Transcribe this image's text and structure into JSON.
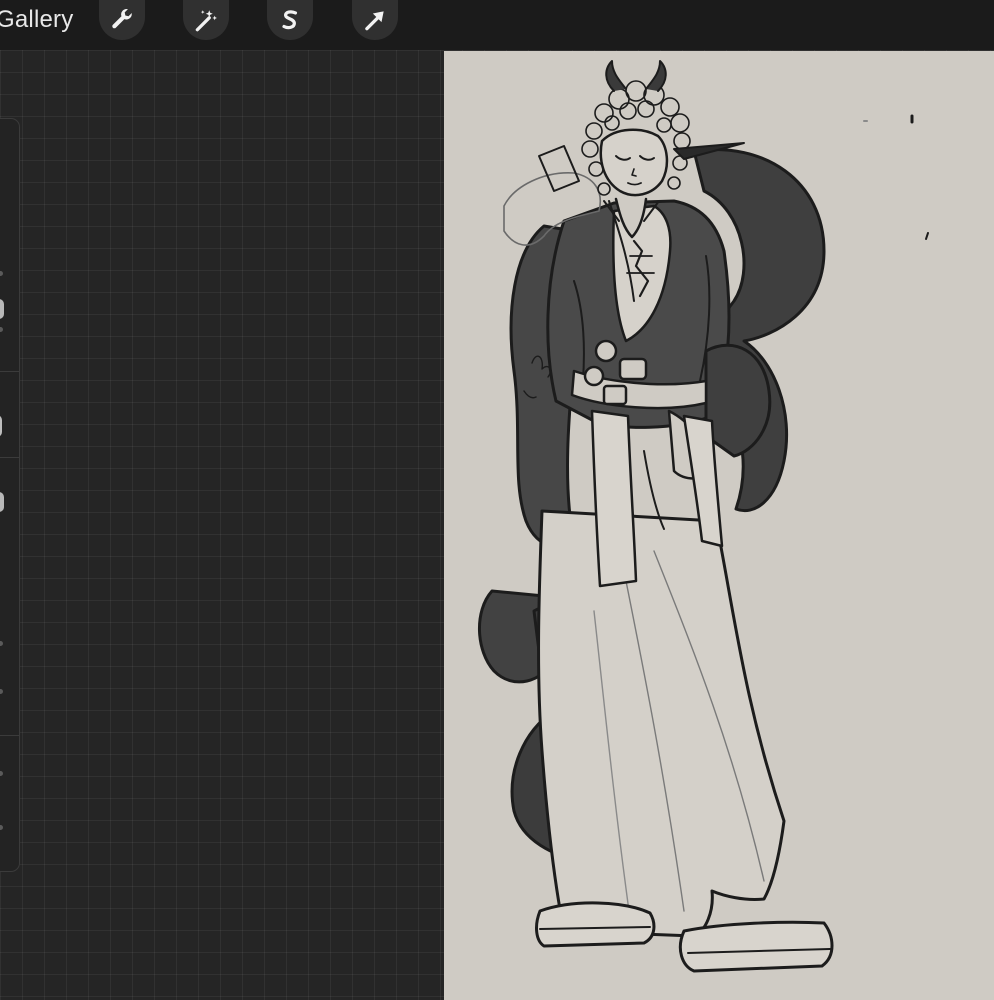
{
  "topbar": {
    "gallery_label": "Gallery",
    "tools": [
      {
        "name": "actions",
        "icon": "wrench-icon"
      },
      {
        "name": "adjustments",
        "icon": "magic-wand-icon"
      },
      {
        "name": "selection",
        "icon": "selection-s-icon"
      },
      {
        "name": "transform",
        "icon": "arrow-cursor-icon"
      }
    ]
  },
  "colors": {
    "topbar": "#1b1b1b",
    "workspace": "#252525",
    "canvas": "#cfcbc4",
    "accent": "#2f7cf6",
    "ink": "#1c1c1c",
    "fill_dark": "#4a4a4a"
  }
}
